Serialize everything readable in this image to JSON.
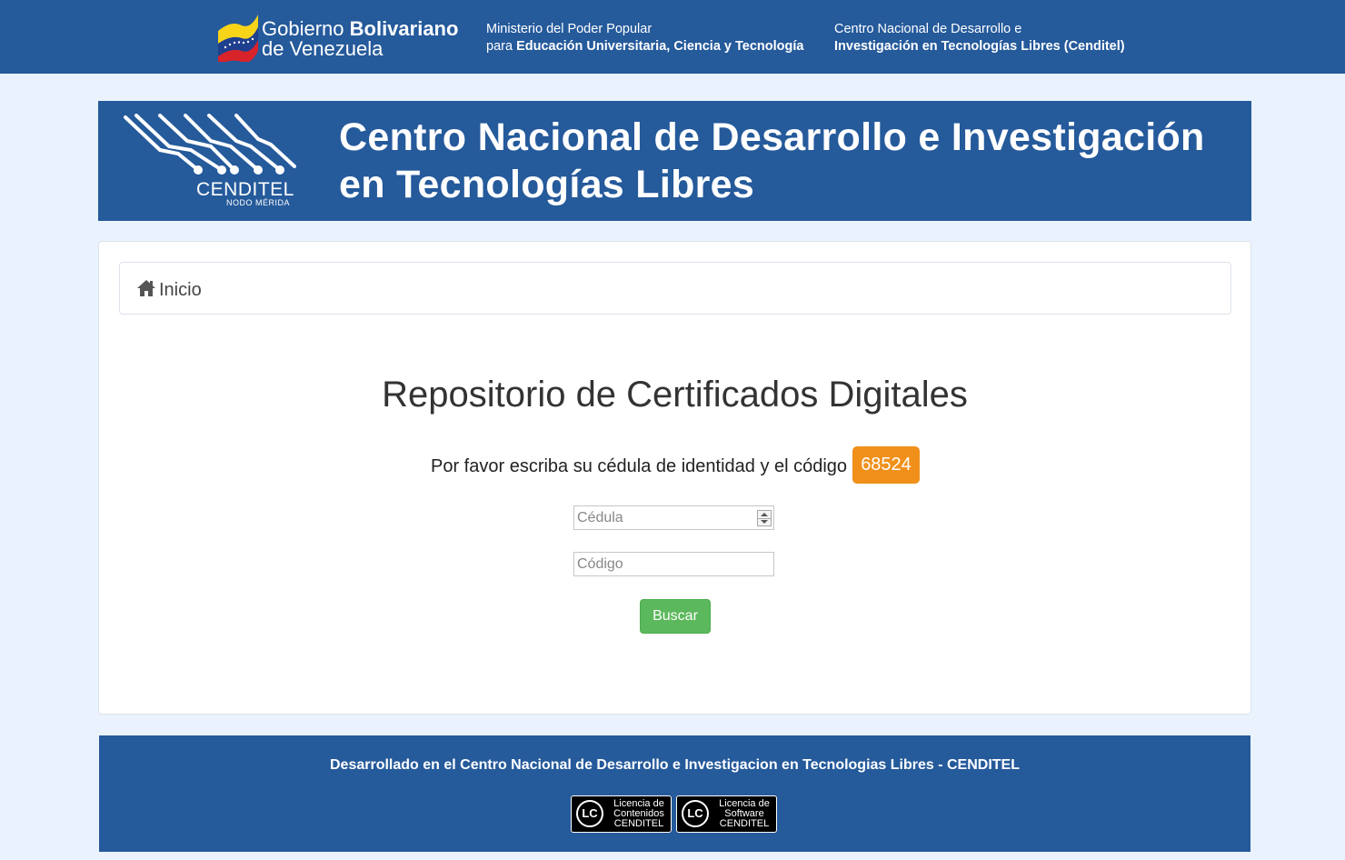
{
  "gov_bar": {
    "title_regular": "Gobierno ",
    "title_bold": "Bolivariano",
    "title_line2": "de Venezuela",
    "ministry_line1": "Ministerio del Poder Popular",
    "ministry_line2_regular": "para ",
    "ministry_line2_bold": "Educación Universitaria, Ciencia y Tecnología",
    "center_line1": "Centro Nacional de Desarrollo e",
    "center_line2": "Investigación en Tecnologías Libres (Cenditel)"
  },
  "banner": {
    "brand": "CENDITEL",
    "brand_sub": "NODO MÉRIDA",
    "title_line1": "Centro Nacional de Desarrollo e Investigación",
    "title_line2": "en Tecnologías Libres"
  },
  "breadcrumb": {
    "home_label": "Inicio",
    "icon": "home-icon"
  },
  "main": {
    "title": "Repositorio de Certificados Digitales",
    "instruction": "Por favor escriba su cédula de identidad y el código",
    "code": "68524",
    "cedula_placeholder": "Cédula",
    "cedula_value": "",
    "codigo_placeholder": "Código",
    "codigo_value": "",
    "search_button": "Buscar"
  },
  "footer": {
    "text": "Desarrollado en el Centro Nacional de Desarrollo e Investigacion en Tecnologias Libres - CENDITEL",
    "badges": [
      {
        "mark": "LC",
        "line1": "Licencia de",
        "line2": "Contenidos",
        "line3": "CENDITEL"
      },
      {
        "mark": "LC",
        "line1": "Licencia de",
        "line2": "Software",
        "line3": "CENDITEL"
      }
    ]
  },
  "colors": {
    "brand_blue": "#255a9b",
    "page_bg": "#eaf3fd",
    "code_badge": "#f0901b",
    "search_button": "#5cb85c"
  }
}
